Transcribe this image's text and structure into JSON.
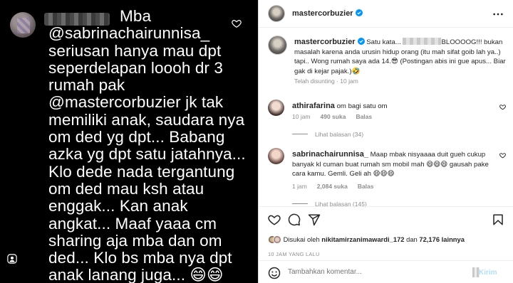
{
  "story": {
    "username_prefix": "Mba",
    "comment_text": "@sabrinachairunnisa_ seriusan hanya mau dpt seperdelapan loooh dr 3 rumah pak @mastercorbuzier jk tak memiliki anak, saudara nya om ded yg dpt... Babang azka yg dpt satu jatahnya... Klo dede nada tergantung om ded mau ksh atau enggak... Kan anak angkat... Maaf yaaa cm sharing aja mba dan om ded... Klo bs mba nya dpt anak lanang juga... 😄😄",
    "icons": {
      "like": "heart-icon",
      "profile": "person-icon"
    }
  },
  "post": {
    "author": "mastercorbuzier",
    "caption_parts": {
      "before_blur": "Satu kata...",
      "after_blur": "BLOOOOG!!! bukan masalah karena anda urusin hidup orang (itu mah sifat goib lah ya..) tapi.. Wong rumah saya ada 14.😎 (Postingan abis ini gue apus... Biar gak di kejar pajak.)🤣"
    },
    "caption_meta": "Telah disunting · 10 jam",
    "comments": [
      {
        "username": "athirafarina",
        "text": "om bagi satu om",
        "time": "10 jam",
        "likes": "490 suka",
        "reply": "Balas",
        "view_replies": "Lihat balasan (34)"
      },
      {
        "username": "sabrinachairunnisa_",
        "text": "Maap mbak nisyaaaa duit gueh cukup banyak kl cuman buat rumah sm mobil mah 😄😄😄 gausah pake cara kamu. Gemli. Geli ah 😄😄😄",
        "time": "1 jam",
        "likes": "2,084 suka",
        "reply": "Balas",
        "view_replies": "Lihat balasan (145)"
      }
    ],
    "liked_by_prefix": "Disukai oleh",
    "liked_by_user": "nikitamirzanimawardi_172",
    "liked_by_and": "dan",
    "liked_by_count": "72,176 lainnya",
    "time_ago": "10 JAM YANG LALU",
    "comment_placeholder": "Tambahkan komentar...",
    "send_label": "Kirim",
    "icons": {
      "verified": "verified-badge-icon",
      "more": "more-options-icon",
      "like": "heart-icon",
      "comment": "comment-icon",
      "share": "share-icon",
      "save": "bookmark-icon",
      "emoji": "emoji-icon"
    },
    "colors": {
      "verified": "#0095f6",
      "muted": "#8e8e8e",
      "text": "#262626",
      "send": "#b2dffc"
    }
  }
}
